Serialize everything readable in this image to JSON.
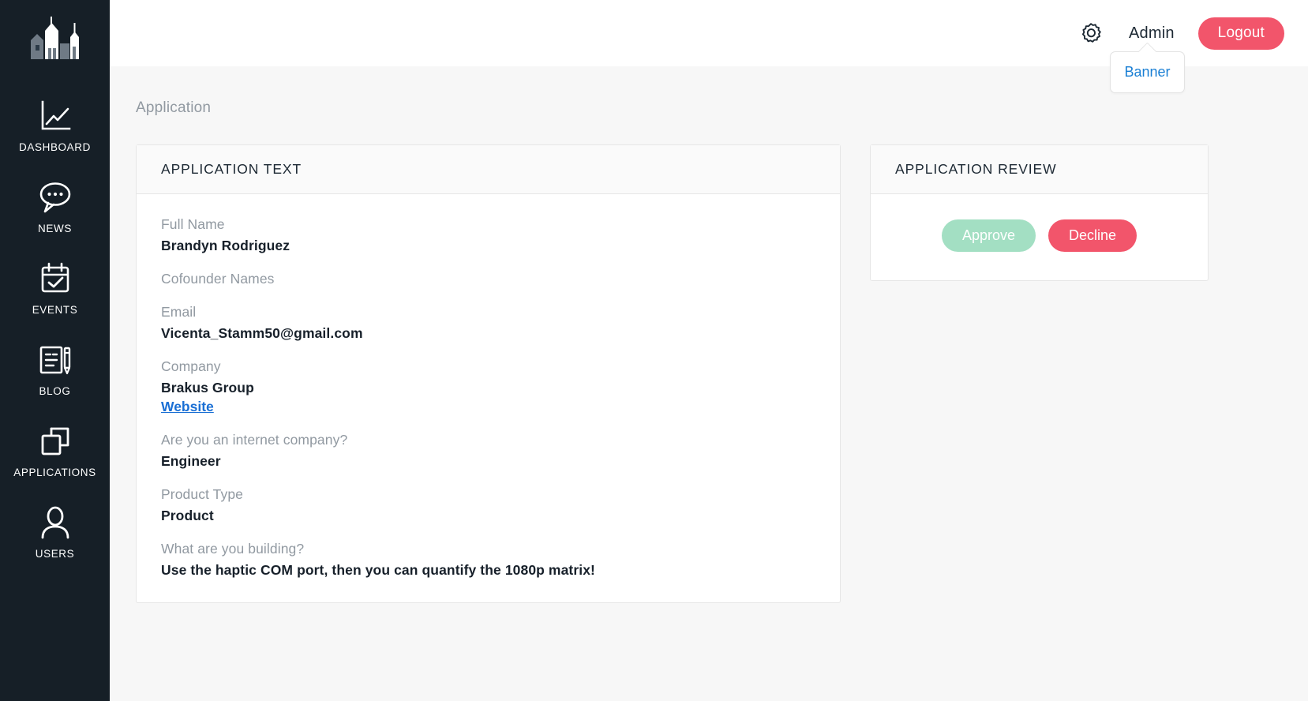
{
  "sidebar": {
    "logo_icon": "city-skyline-logo",
    "items": [
      {
        "label": "DASHBOARD",
        "icon": "line-chart-icon"
      },
      {
        "label": "NEWS",
        "icon": "speech-bubble-icon"
      },
      {
        "label": "EVENTS",
        "icon": "calendar-check-icon"
      },
      {
        "label": "BLOG",
        "icon": "document-pencil-icon"
      },
      {
        "label": "APPLICATIONS",
        "icon": "copy-squares-icon"
      },
      {
        "label": "USERS",
        "icon": "user-person-icon"
      }
    ]
  },
  "topbar": {
    "gear_icon": "gear-icon",
    "admin_label": "Admin",
    "logout_label": "Logout",
    "dropdown": {
      "banner_label": "Banner"
    }
  },
  "breadcrumb": "Application",
  "application_text": {
    "title": "APPLICATION TEXT",
    "fields": [
      {
        "label": "Full Name",
        "value": "Brandyn Rodriguez"
      },
      {
        "label": "Cofounder Names",
        "value": ""
      },
      {
        "label": "Email",
        "value": "Vicenta_Stamm50@gmail.com"
      },
      {
        "label": "Company",
        "value": "Brakus Group",
        "link": "Website"
      },
      {
        "label": "Are you an internet company?",
        "value": "Engineer"
      },
      {
        "label": "Product Type",
        "value": "Product"
      },
      {
        "label": "What are you building?",
        "value": "Use the haptic COM port, then you can quantify the 1080p matrix!"
      }
    ]
  },
  "application_review": {
    "title": "APPLICATION REVIEW",
    "approve_label": "Approve",
    "decline_label": "Decline"
  },
  "colors": {
    "sidebar_bg": "#161f27",
    "accent_pink": "#f2556b",
    "accent_green": "#a3dfc3",
    "link_blue": "#1a6fd4",
    "content_bg": "#f7f7f7",
    "muted_text": "#9199a1"
  }
}
